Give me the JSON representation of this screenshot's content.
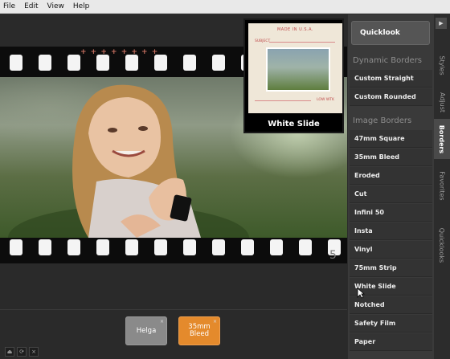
{
  "menu": [
    "File",
    "Edit",
    "View",
    "Help"
  ],
  "quicklook": {
    "caption": "White Slide",
    "slide_made": "MADE IN U.S.A.",
    "slide_subject": "SUBJECT",
    "slide_low": "LOW WTK"
  },
  "film": {
    "edge_text": "+ + + + + + + +",
    "frame_number": "5"
  },
  "panel": {
    "quicklook_button": "Quicklook",
    "dynamic_heading": "Dynamic Borders",
    "dynamic_items": [
      "Custom Straight",
      "Custom Rounded"
    ],
    "image_heading": "Image Borders",
    "image_items": [
      "47mm Square",
      "35mm Bleed",
      "Eroded",
      "Cut",
      "Infini 50",
      "Insta",
      "Vinyl",
      "75mm Strip",
      "White Slide",
      "Notched",
      "Safety Film",
      "Paper"
    ]
  },
  "tabs": [
    "Styles",
    "Adjust",
    "Borders",
    "Favorites",
    "Quicklooks"
  ],
  "active_tab": "Borders",
  "tray": {
    "cards": [
      "Helga",
      "35mm\nBleed"
    ],
    "card_close": "×"
  },
  "tools": [
    "⏏",
    "⟳",
    "×"
  ],
  "icons": {
    "collapse": "triangle-right-icon"
  }
}
